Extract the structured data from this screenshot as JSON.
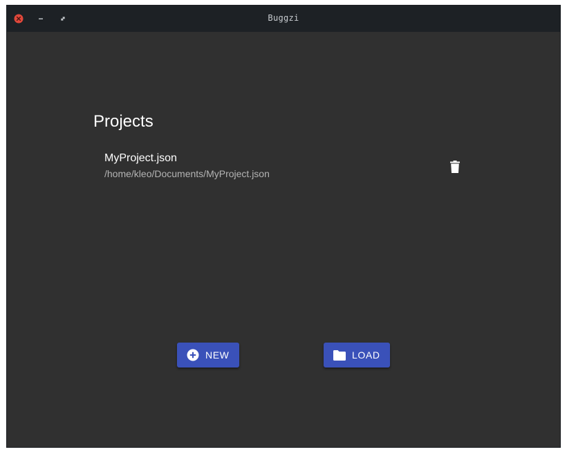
{
  "window": {
    "title": "Buggzi"
  },
  "titlebar_controls": {
    "close_icon": "close-icon",
    "minimize_icon": "minimize-icon",
    "maximize_icon": "maximize-icon",
    "close_color": "#e0483b"
  },
  "main": {
    "heading": "Projects",
    "projects": [
      {
        "name": "MyProject.json",
        "path": "/home/kleo/Documents/MyProject.json",
        "action_icon": "trash-icon"
      }
    ]
  },
  "actions": {
    "new_label": "NEW",
    "new_icon": "plus-circle-icon",
    "load_label": "LOAD",
    "load_icon": "folder-icon"
  },
  "colors": {
    "background": "#303030",
    "titlebar": "#1d2125",
    "button": "#3a51b9"
  }
}
